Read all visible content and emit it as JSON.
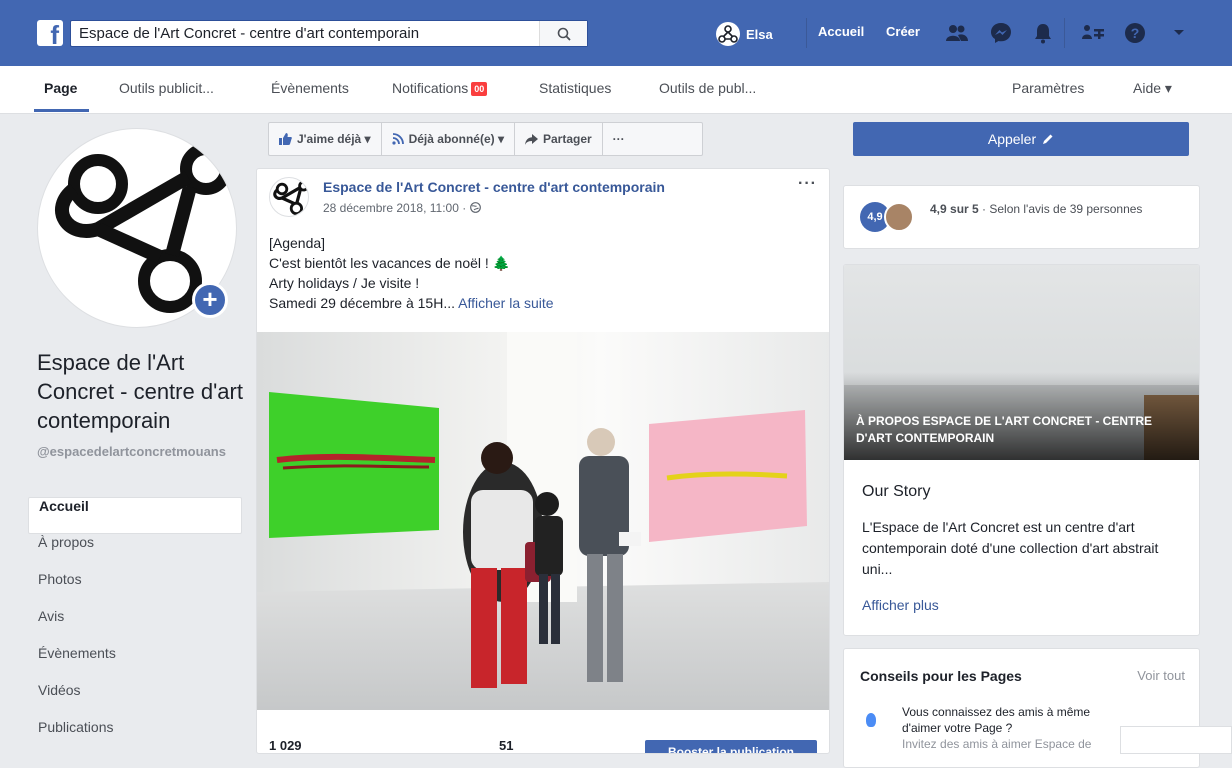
{
  "topbar": {
    "search_value": "Espace de l'Art Concret - centre d'art contemporain",
    "user_name": "Elsa",
    "home_label": "Accueil",
    "create_label": "Créer"
  },
  "subnav": {
    "tabs": [
      {
        "label": "Page"
      },
      {
        "label": "Outils publicit..."
      },
      {
        "label": "Évènements"
      },
      {
        "label": "Notifications"
      },
      {
        "label": "Statistiques"
      },
      {
        "label": "Outils de publ..."
      },
      {
        "label": "Paramètres"
      },
      {
        "label": "Aide ▾"
      }
    ],
    "notifications_badge": "00"
  },
  "page": {
    "name": "Espace de l'Art Concret - centre d'art contemporain",
    "handle": "@espacedelartconcretmouans"
  },
  "sidebar": {
    "items": [
      {
        "label": "Accueil"
      },
      {
        "label": "À propos"
      },
      {
        "label": "Photos"
      },
      {
        "label": "Avis"
      },
      {
        "label": "Évènements"
      },
      {
        "label": "Vidéos"
      },
      {
        "label": "Publications"
      }
    ]
  },
  "actions": {
    "like": "J'aime déjà ▾",
    "follow": "Déjà abonné(e) ▾",
    "share": "Partager",
    "more": "···"
  },
  "post": {
    "author": "Espace de l'Art Concret - centre d'art contemporain",
    "date": "28 décembre 2018, 11:00 ·",
    "more": "···",
    "line1": "[Agenda]",
    "line2": "C'est bientôt les vacances de noël ! 🌲",
    "line3": "Arty holidays / Je visite !",
    "line4": "Samedi 29 décembre à 15H...",
    "see_more": "Afficher la suite",
    "reach": "1 029",
    "engagement": "51",
    "boost": "Booster la publication"
  },
  "right": {
    "call_label": "Appeler",
    "rating_value": "4,9",
    "rating_strong": "4,9 sur 5",
    "rating_rest": " · Selon l'avis de 39 personnes",
    "about_caption": "À PROPOS ESPACE DE L'ART CONCRET - CENTRE D'ART CONTEMPORAIN",
    "story_title": "Our Story",
    "story_text": "L'Espace de l'Art Concret est un centre d'art contemporain doté d'une collection d'art abstrait uni...",
    "story_more": "Afficher plus",
    "tips_title": "Conseils pour les Pages",
    "tips_all": "Voir tout",
    "tip_text": "Vous connaissez des amis à même d'aimer votre Page ?",
    "tip_sub": "Invitez des amis à aimer Espace de"
  },
  "colors": {
    "brand": "#4267b2",
    "link": "#385898",
    "badge": "#fa3e3e"
  }
}
